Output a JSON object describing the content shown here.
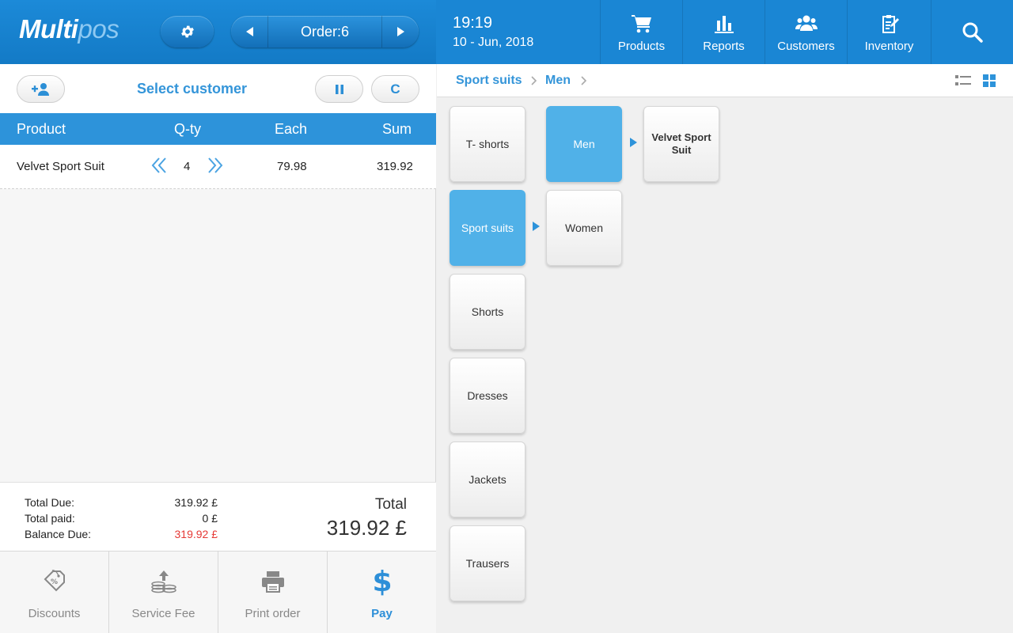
{
  "app": {
    "logo_bold": "Multi",
    "logo_light": "pos"
  },
  "header": {
    "order_label": "Order:6",
    "time": "19:19",
    "date": "10 - Jun, 2018",
    "nav": [
      {
        "label": "Products",
        "icon": "cart-icon"
      },
      {
        "label": "Reports",
        "icon": "bar-chart-icon"
      },
      {
        "label": "Customers",
        "icon": "users-icon"
      },
      {
        "label": "Inventory",
        "icon": "clipboard-edit-icon"
      }
    ],
    "search_icon": "search-icon"
  },
  "customer_bar": {
    "select_customer": "Select customer",
    "clear_label": "C"
  },
  "order_table": {
    "columns": [
      "Product",
      "Q-ty",
      "Each",
      "Sum"
    ],
    "rows": [
      {
        "product": "Velvet Sport Suit",
        "qty": "4",
        "each": "79.98",
        "sum": "319.92"
      }
    ]
  },
  "totals": {
    "total_due_label": "Total Due:",
    "total_due": "319.92 £",
    "total_paid_label": "Total paid:",
    "total_paid": "0 £",
    "balance_due_label": "Balance Due:",
    "balance_due": "319.92 £",
    "total_label": "Total",
    "total_value": "319.92 £"
  },
  "actions": [
    {
      "label": "Discounts",
      "icon": "discount-tag-icon"
    },
    {
      "label": "Service Fee",
      "icon": "coins-icon"
    },
    {
      "label": "Print order",
      "icon": "printer-icon"
    },
    {
      "label": "Pay",
      "icon": "dollar-icon"
    }
  ],
  "breadcrumb": [
    "Sport suits",
    "Men"
  ],
  "categories": [
    "T- shorts",
    "Sport suits",
    "Shorts",
    "Dresses",
    "Jackets",
    "Trausers"
  ],
  "subcategories": [
    "Men",
    "Women"
  ],
  "products": [
    "Velvet Sport Suit"
  ],
  "colors": {
    "primary": "#1a86d4",
    "accent": "#50b1e8",
    "balance_due": "#e53935"
  }
}
